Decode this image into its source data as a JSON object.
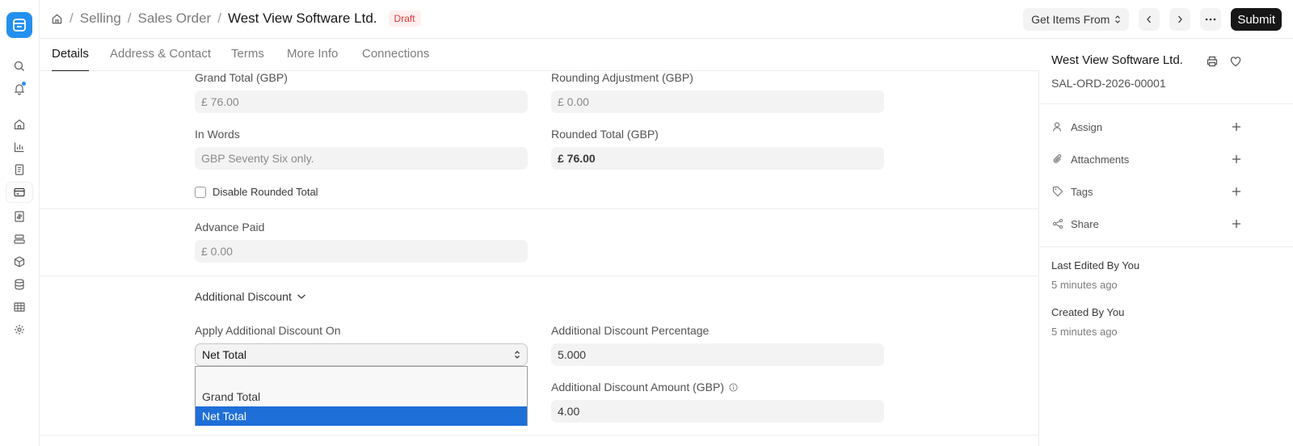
{
  "header": {
    "breadcrumbs": [
      "Selling",
      "Sales Order"
    ],
    "title": "West View Software Ltd.",
    "status": "Draft",
    "get_items_label": "Get Items From",
    "submit_label": "Submit"
  },
  "tabs": [
    "Details",
    "Address & Contact",
    "Terms",
    "More Info",
    "Connections"
  ],
  "fields": {
    "grand_total_label": "Grand Total (GBP)",
    "grand_total_value": "£ 76.00",
    "rounding_adj_label": "Rounding Adjustment (GBP)",
    "rounding_adj_value": "£ 0.00",
    "in_words_label": "In Words",
    "in_words_value": "GBP Seventy Six only.",
    "rounded_total_label": "Rounded Total (GBP)",
    "rounded_total_value": "£ 76.00",
    "disable_rounded_label": "Disable Rounded Total",
    "advance_paid_label": "Advance Paid",
    "advance_paid_value": "£ 0.00",
    "additional_discount_section": "Additional Discount",
    "apply_discount_on_label": "Apply Additional Discount On",
    "apply_discount_on_value": "Net Total",
    "discount_pct_label": "Additional Discount Percentage",
    "discount_pct_value": "5.000",
    "discount_amt_label": "Additional Discount Amount (GBP)",
    "discount_amt_value": "4.00"
  },
  "dropdown": {
    "options": [
      "",
      "Grand Total",
      "Net Total"
    ],
    "selected": "Net Total"
  },
  "right_panel": {
    "title": "West View Software Ltd.",
    "doc_id": "SAL-ORD-2026-00001",
    "assign": "Assign",
    "attachments": "Attachments",
    "tags": "Tags",
    "share": "Share",
    "last_edited": "Last Edited By You",
    "last_edited_time": "5 minutes ago",
    "created": "Created By You",
    "created_time": "5 minutes ago"
  },
  "colors": {
    "accent": "#2490ef",
    "selected_option": "#1f6fd9",
    "draft": "#e03636"
  }
}
